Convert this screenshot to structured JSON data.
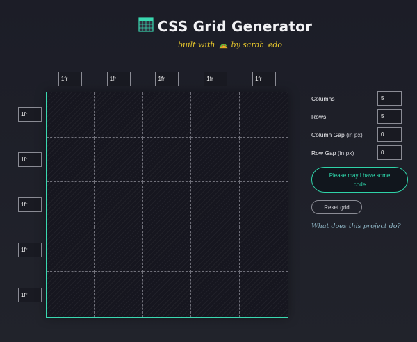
{
  "header": {
    "title": "CSS Grid Generator",
    "subtitle_prefix": "built with",
    "subtitle_suffix": "by sarah_edo",
    "logo_icon": "grid-icon",
    "taco_icon": "taco-icon"
  },
  "colors": {
    "accent": "#2fd3a8",
    "subtitle": "#e6c62c",
    "background": "#1c1d27"
  },
  "columns": [
    "1fr",
    "1fr",
    "1fr",
    "1fr",
    "1fr"
  ],
  "rows": [
    "1fr",
    "1fr",
    "1fr",
    "1fr",
    "1fr"
  ],
  "controls": {
    "columns_label": "Columns",
    "columns_value": "5",
    "rows_label": "Rows",
    "rows_value": "5",
    "column_gap_label": "Column Gap",
    "column_gap_unit": "(in px)",
    "column_gap_value": "0",
    "row_gap_label": "Row Gap",
    "row_gap_unit": "(in px)",
    "row_gap_value": "0"
  },
  "buttons": {
    "code": "Please may I have some code",
    "reset": "Reset grid"
  },
  "about_link": "What does this project do?"
}
